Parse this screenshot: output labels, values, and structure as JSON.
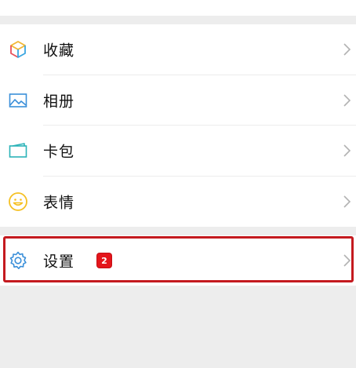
{
  "menu": {
    "items": [
      {
        "label": "收藏",
        "icon": "favorites-cube-icon"
      },
      {
        "label": "相册",
        "icon": "album-picture-icon"
      },
      {
        "label": "卡包",
        "icon": "card-wallet-icon"
      },
      {
        "label": "表情",
        "icon": "smiley-face-icon"
      }
    ]
  },
  "settings": {
    "label": "设置",
    "icon": "gear-icon",
    "badge": "2",
    "highlight_color": "#c41a1f"
  },
  "colors": {
    "background": "#ededed",
    "row": "#ffffff",
    "badge": "#e4151b",
    "chevron": "#b2b2b2"
  }
}
